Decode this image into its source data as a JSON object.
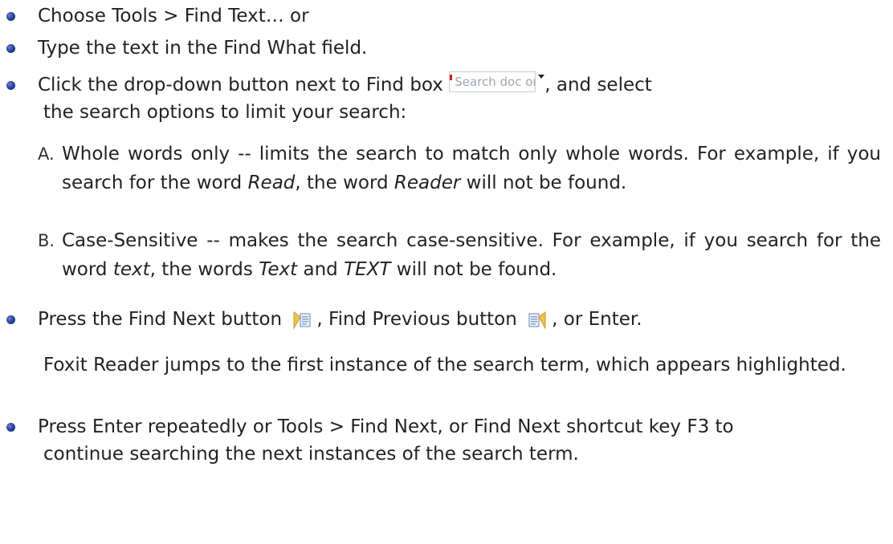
{
  "items": [
    {
      "text": "Choose Tools > Find Text… or"
    },
    {
      "text": "Type the text in the Find What field."
    },
    {
      "before": "Click the drop-down button next to Find box ",
      "search_box": {
        "placeholder": "Search doc or web",
        "icon": "dropdown-arrow-icon"
      },
      "after": ", and select",
      "continuation": "the search options to limit your search:"
    },
    {
      "before": "Press the Find Next button ",
      "next_icon": "find-next-icon",
      "middle": ", Find Previous button ",
      "prev_icon": "find-previous-icon",
      "after": ", or Enter."
    },
    {
      "text": "Press Enter repeatedly or Tools > Find Next, or Find Next shortcut key F3 to",
      "continuation": "continue searching the next instances of the search term."
    }
  ],
  "options": [
    {
      "label": "A.",
      "p1": "Whole words only -- limits the search to match only whole words. For example, if you search for the word ",
      "em1": "Read",
      "p2": ", the word ",
      "em2": "Reader",
      "p3": " will not be found."
    },
    {
      "label": "B.",
      "p1": "Case-Sensitive -- makes the search case-sensitive. For example, if you search for the word ",
      "em1": "text",
      "p2": ", the words ",
      "em2": "Text",
      "p3": " and ",
      "em3": "TEXT",
      "p4": " will not be found."
    }
  ],
  "result_note": "Foxit Reader jumps to the first instance of the search term, which appears highlighted."
}
